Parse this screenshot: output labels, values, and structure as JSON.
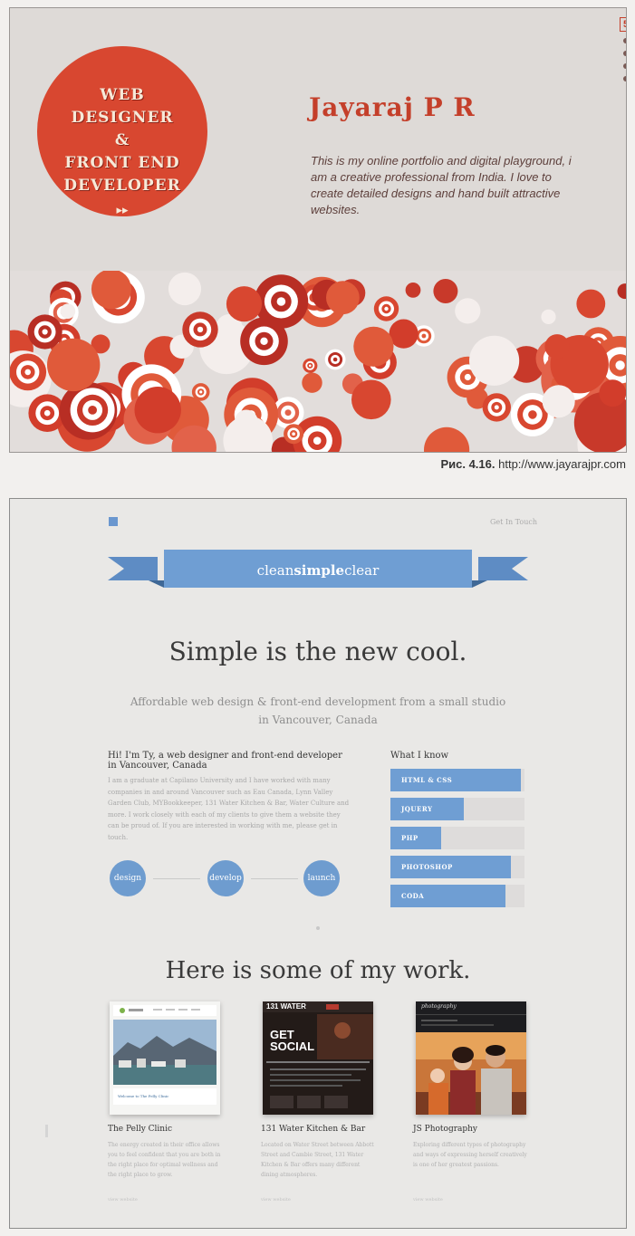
{
  "figure1": {
    "badge": {
      "lines": [
        "WEB",
        "DESIGNER",
        "&",
        "FRONT END",
        "DEVELOPER"
      ],
      "arrow": "▸▸"
    },
    "name": "Jayaraj P R",
    "intro": "This is my online portfolio and digital playground, i am a creative professional from India. I love to create detailed designs and hand built attractive websites.",
    "side_tab": {
      "number": "5"
    },
    "colors": {
      "accent": "#d84730",
      "background": "#dedad7"
    },
    "caption": {
      "label": "Рис. 4.16.",
      "url": "http://www.jayarajpr.com"
    }
  },
  "figure2": {
    "top_link": "Get In Touch",
    "ribbon": {
      "part1": "clean",
      "part2": "simple",
      "part3": "clear"
    },
    "headline": "Simple is the new cool.",
    "subhead": "Affordable web design & front-end development from a small studio in Vancouver, Canada",
    "about": {
      "title": "Hi! I'm Ty, a web designer and front-end developer in Vancouver, Canada",
      "body": "I am a graduate at Capilano University and I have worked with many companies in and around Vancouver such as Eau Canada, Lynn Valley Garden Club, MYBookkeeper, 131 Water Kitchen & Bar, Water Culture and more. I work closely with each of my clients to give them a website they can be proud of. If you are interested in working with me, please get in touch."
    },
    "process": [
      "design",
      "develop",
      "launch"
    ],
    "skills": {
      "title": "What I know",
      "items": [
        {
          "label": "HTML & CSS",
          "level": 0.97
        },
        {
          "label": "JQUERY",
          "level": 0.55
        },
        {
          "label": "PHP",
          "level": 0.38
        },
        {
          "label": "PHOTOSHOP",
          "level": 0.9
        },
        {
          "label": "CODA",
          "level": 0.86
        }
      ]
    },
    "work_title": "Here is some of my work.",
    "works": [
      {
        "name": "The Pelly Clinic",
        "desc": "The energy created in their office allows you to feel confident that you are both in the right place for optimal wellness and the right place to grow.",
        "link": "view website",
        "thumb_caption": "Welcome to The Pelly Clinic"
      },
      {
        "name": "131 Water Kitchen & Bar",
        "desc": "Located on Water Street between Abbott Street and Cambie Street, 131 Water Kitchen & Bar offers many different dining atmospheres.",
        "link": "view website",
        "thumb_header": "131 WATER",
        "thumb_text": "GET SOCIAL"
      },
      {
        "name": "JS Photography",
        "desc": "Exploring different types of photography and ways of expressing herself creatively is one of her greatest passions.",
        "link": "view website",
        "thumb_header": "photography"
      }
    ],
    "colors": {
      "accent": "#6f9ed3",
      "background": "#e9e8e6"
    }
  }
}
